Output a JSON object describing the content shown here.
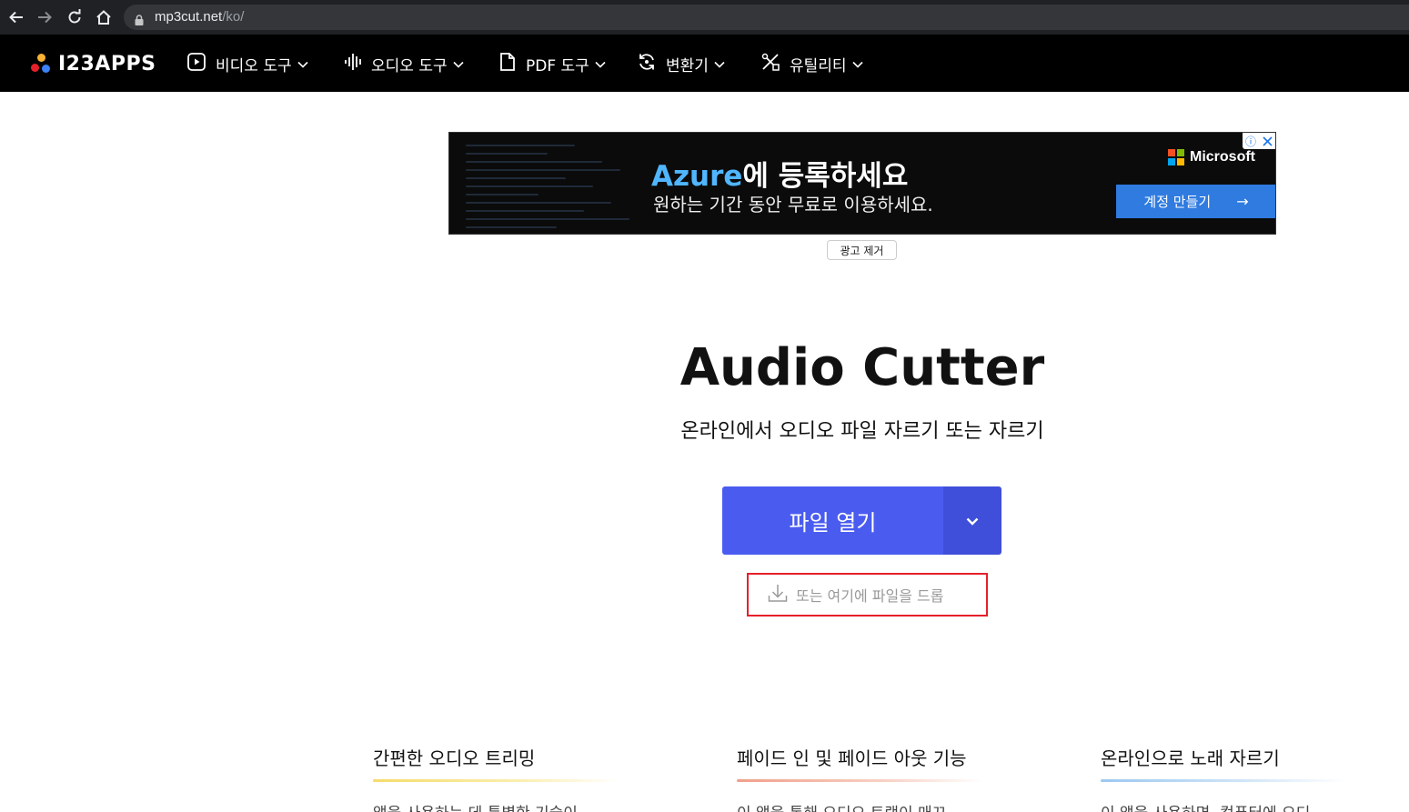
{
  "browser": {
    "url_domain": "mp3cut.net",
    "url_path": "/ko/"
  },
  "nav": {
    "logo_text": "I23APPS",
    "items": [
      {
        "label": "비디오 도구",
        "icon": "play-square-icon"
      },
      {
        "label": "오디오 도구",
        "icon": "waveform-icon"
      },
      {
        "label": "PDF 도구",
        "icon": "document-icon"
      },
      {
        "label": "변환기",
        "icon": "convert-icon"
      },
      {
        "label": "유틸리티",
        "icon": "tools-icon"
      }
    ]
  },
  "ad": {
    "title_brand": "Azure",
    "title_rest": "에 등록하세요",
    "subtitle": "원하는 기간 동안 무료로 이용하세요.",
    "brand_name": "Microsoft",
    "cta_label": "계정 만들기",
    "cta_arrow": "→",
    "info_glyph": "ⓘ",
    "remove_label": "광고 제거"
  },
  "hero": {
    "title": "Audio Cutter",
    "subtitle": "온라인에서 오디오 파일 자르기 또는 자르기",
    "open_button": "파일 열기",
    "drop_text": "또는 여기에 파일을 드롭"
  },
  "features": [
    {
      "title": "간편한 오디오 트리밍",
      "text": "앱을 사용하는 데 특별한 기술이",
      "accent": "#f5dc6a"
    },
    {
      "title": "페이드 인 및 페이드 아웃 기능",
      "text": "이 앱을 통해 오디오 트랙이 매끄",
      "accent": "#f0a08a"
    },
    {
      "title": "온라인으로 노래 자르기",
      "text": "이 앱을 사용하면, 컴퓨터에 오디",
      "accent": "#9cc8f0"
    }
  ],
  "colors": {
    "primary_button": "#4a5cf0",
    "drop_highlight": "#e5202a",
    "logo_dots": [
      "#f9b233",
      "#e5202a",
      "#3b82f6"
    ]
  }
}
